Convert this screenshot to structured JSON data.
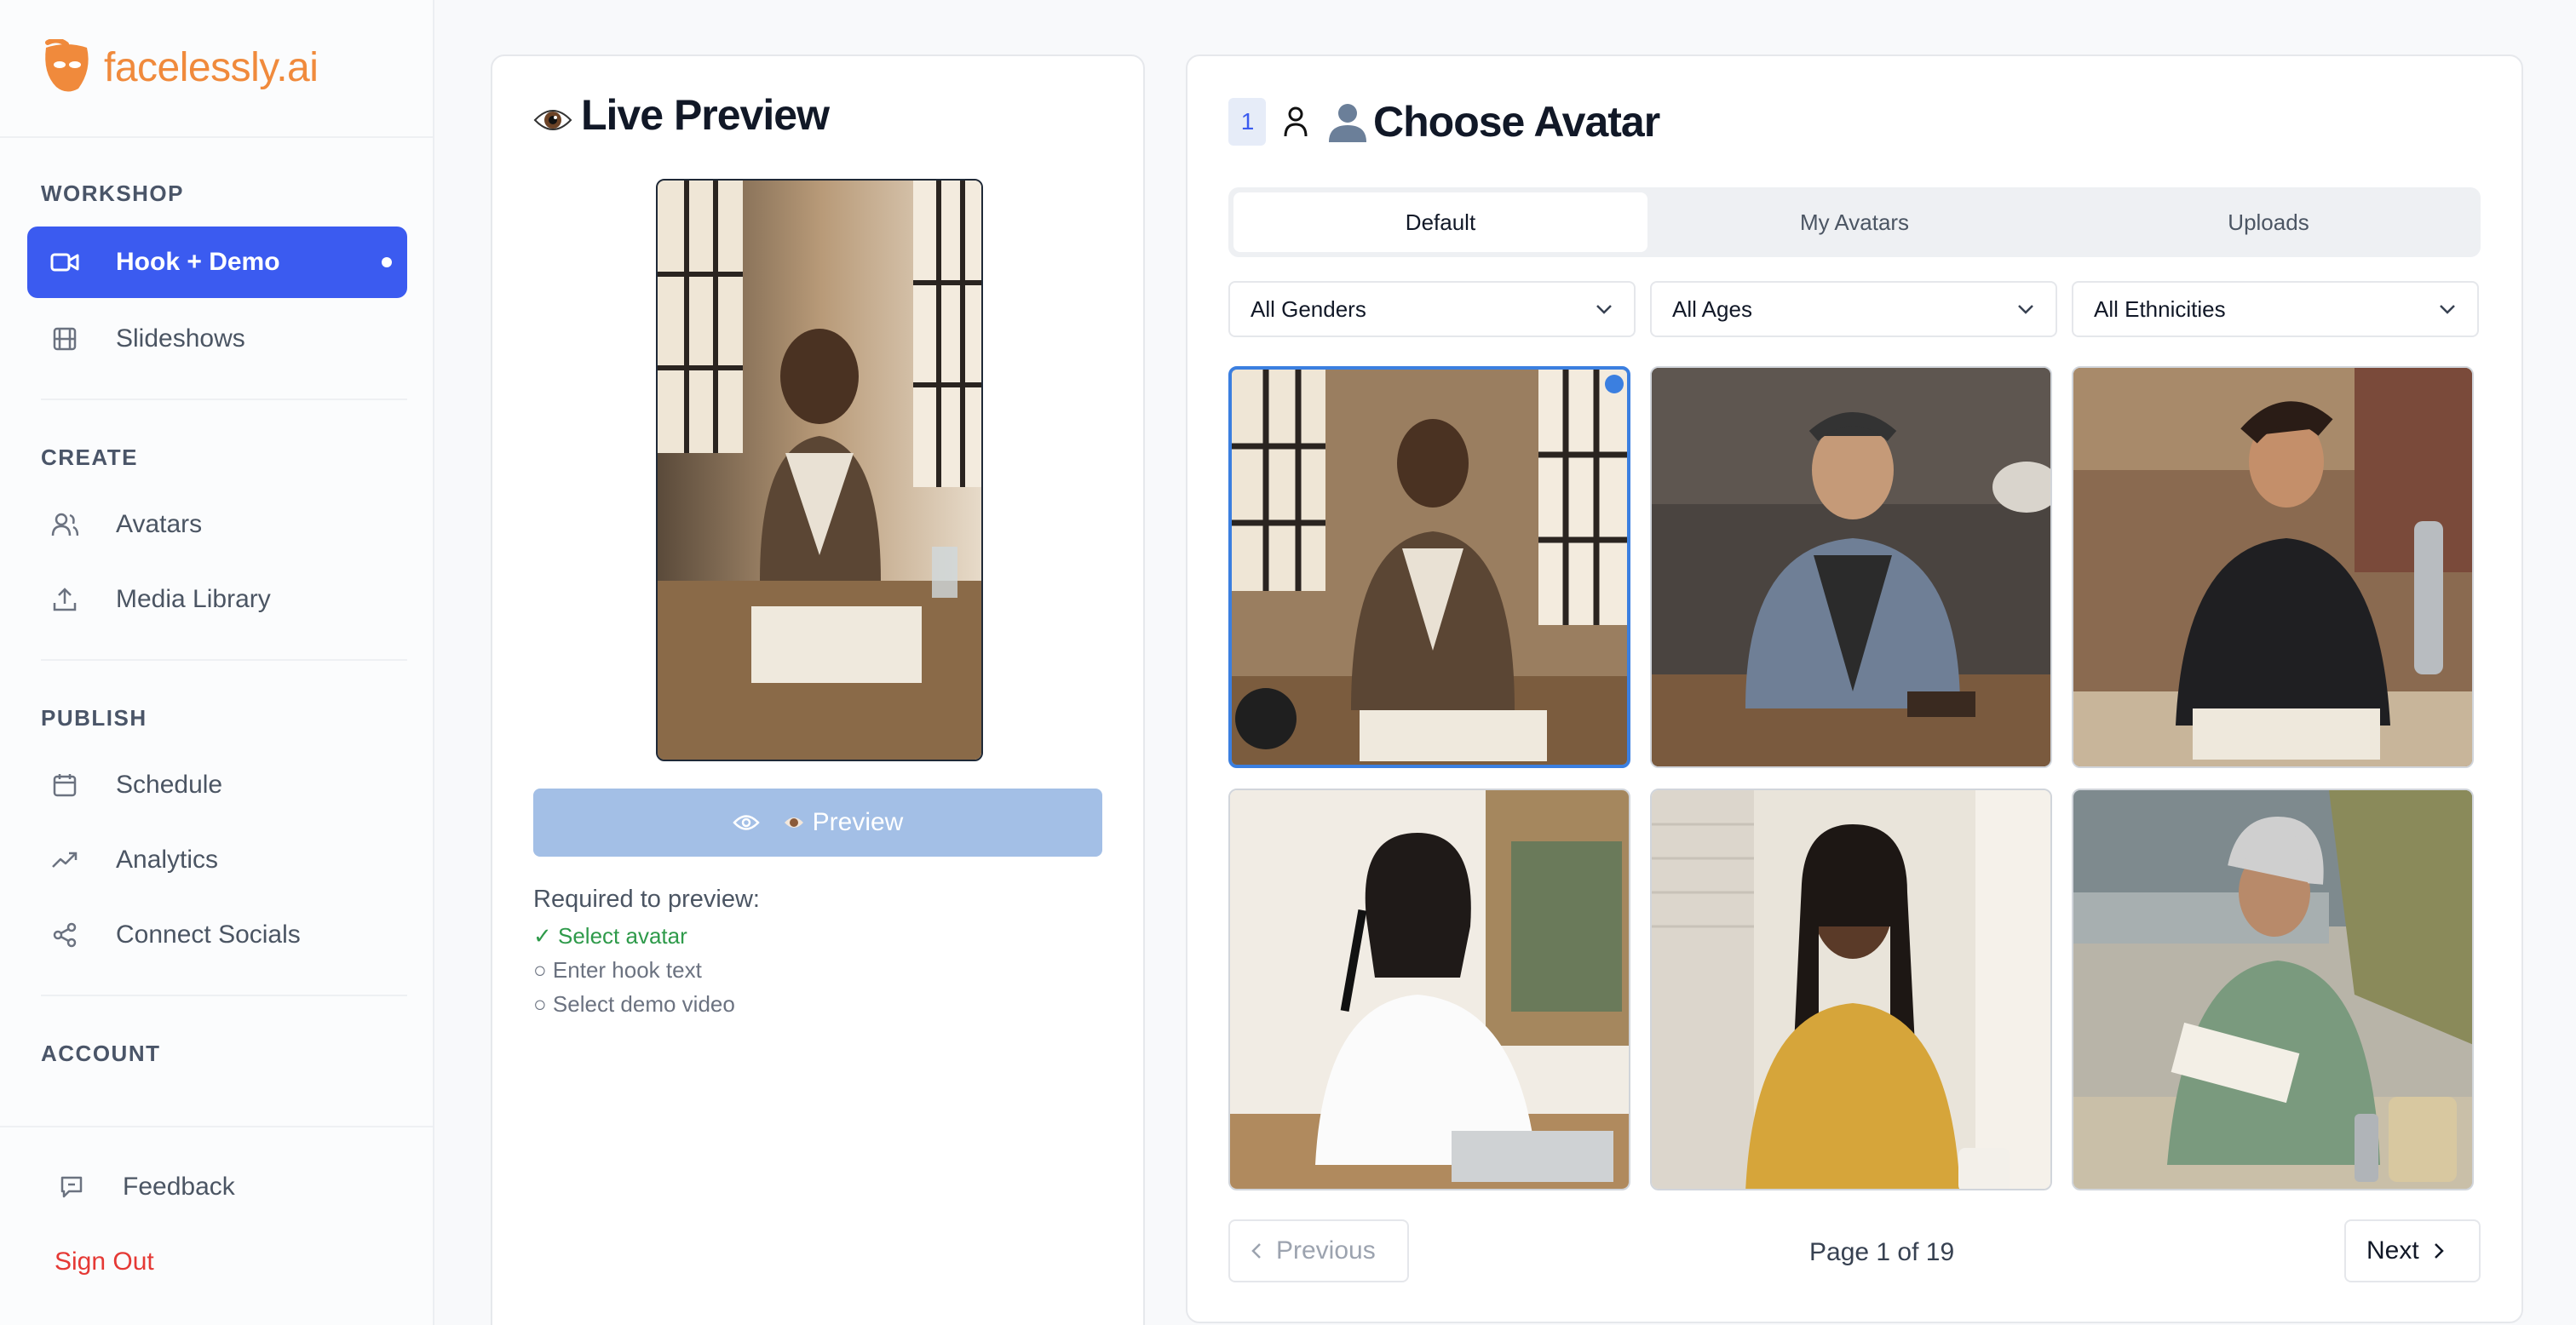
{
  "brand": {
    "name": "facelessly.ai"
  },
  "sidebar": {
    "sections": {
      "workshop": "WORKSHOP",
      "create": "CREATE",
      "publish": "PUBLISH",
      "account": "ACCOUNT"
    },
    "items": {
      "hook_demo": "Hook + Demo",
      "slideshows": "Slideshows",
      "avatars": "Avatars",
      "media_library": "Media Library",
      "schedule": "Schedule",
      "analytics": "Analytics",
      "connect_socials": "Connect Socials",
      "feedback": "Feedback",
      "sign_out": "Sign Out"
    }
  },
  "preview": {
    "title": "Live Preview",
    "button_label": "Preview",
    "required_title": "Required to preview:",
    "requirements": [
      {
        "text": "✓ Select avatar",
        "done": true
      },
      {
        "text": "○ Enter hook text",
        "done": false
      },
      {
        "text": "○ Select demo video",
        "done": false
      }
    ]
  },
  "avatar": {
    "step": "1",
    "title": "Choose Avatar",
    "tabs": [
      "Default",
      "My Avatars",
      "Uploads"
    ],
    "active_tab": "Default",
    "filters": [
      "All Genders",
      "All Ages",
      "All Ethnicities"
    ],
    "selected_index": 0,
    "pagination": {
      "previous": "Previous",
      "page_info": "Page 1 of 19",
      "next": "Next"
    }
  },
  "colors": {
    "accent": "#3b5bf0",
    "brand": "#f08a3c",
    "success": "#2e9a4a",
    "danger": "#e53935"
  }
}
